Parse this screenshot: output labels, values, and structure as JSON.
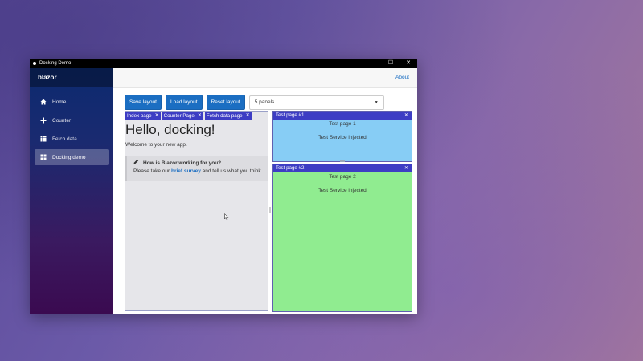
{
  "window": {
    "title": "Docking Demo",
    "controls": [
      "–",
      "☐",
      "✕"
    ]
  },
  "sidebar": {
    "brand": "blazor",
    "items": [
      {
        "label": "Home",
        "icon": "home-icon"
      },
      {
        "label": "Counter",
        "icon": "plus-icon"
      },
      {
        "label": "Fetch data",
        "icon": "list-icon"
      },
      {
        "label": "Docking demo",
        "icon": "grid-icon",
        "active": true
      }
    ]
  },
  "topbar": {
    "about": "About"
  },
  "toolbar": {
    "save_label": "Save layout",
    "load_label": "Load layout",
    "reset_label": "Reset layout",
    "panels_select": "5 panels"
  },
  "left_dock": {
    "tabs": [
      "Index page",
      "Counter Page",
      "Fetch data page"
    ],
    "heading": "Hello, docking!",
    "welcome": "Welcome to your new app.",
    "survey": {
      "title": "How is Blazor working for you?",
      "text_before": "Please take our",
      "link": "brief survey",
      "text_after": "and tell us what you think."
    }
  },
  "panels": [
    {
      "title": "Test page #1",
      "line1": "Test page 1",
      "line2": "Test Service injected",
      "color": "#87cdf5"
    },
    {
      "title": "Test page #2",
      "line1": "Test page 2",
      "line2": "Test Service injected",
      "color": "#90ec90"
    }
  ],
  "colors": {
    "accent": "#1b6ec2",
    "tab": "#3d3dc4"
  }
}
